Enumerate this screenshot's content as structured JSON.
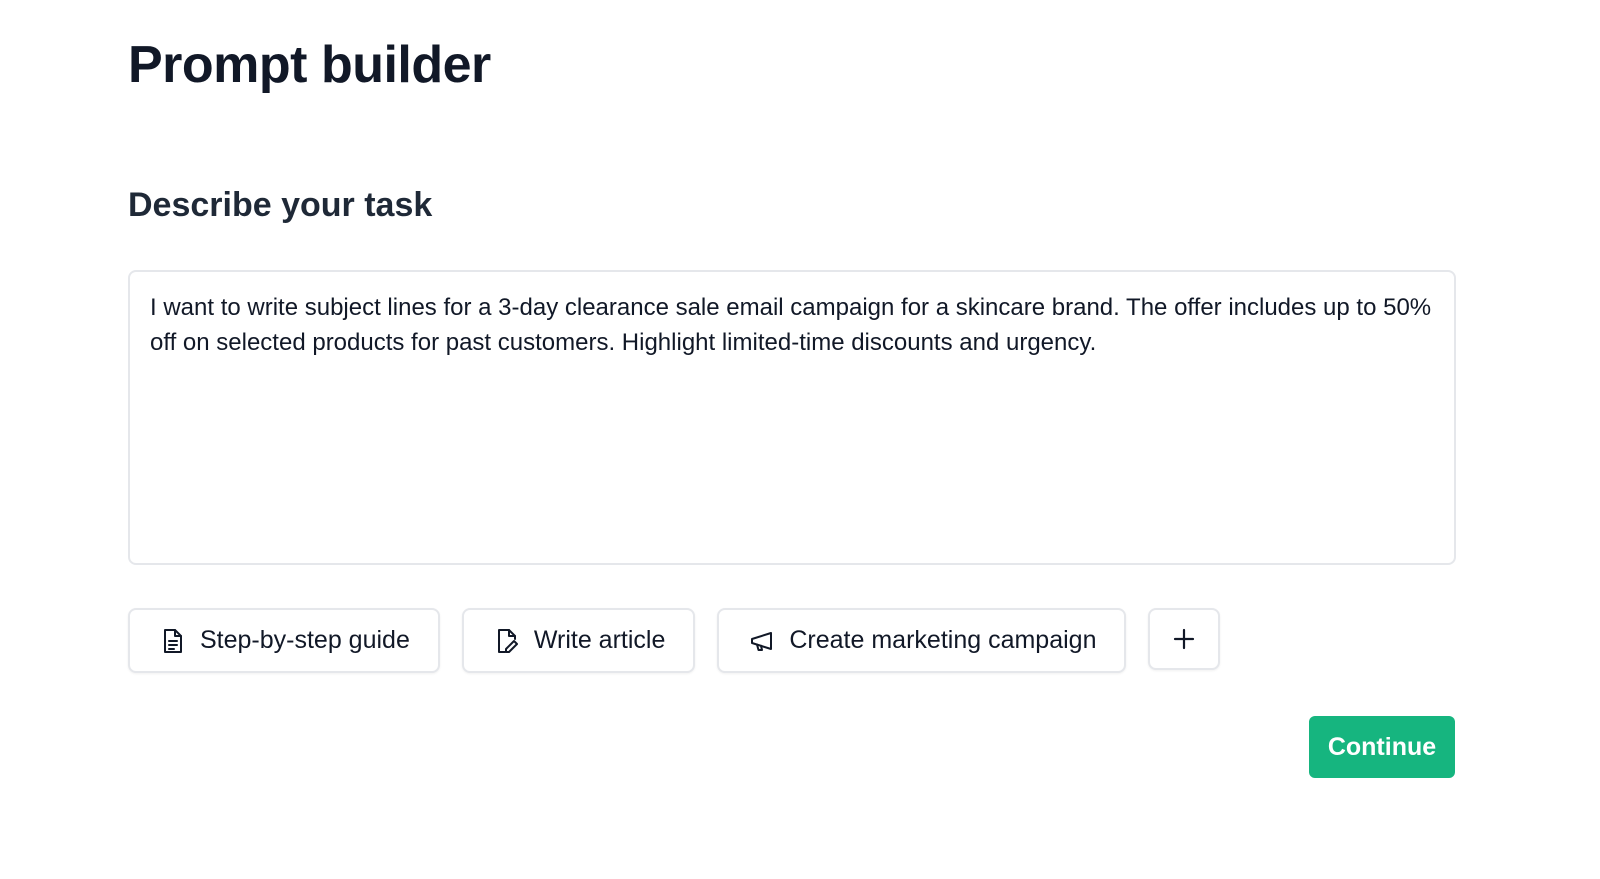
{
  "page": {
    "title": "Prompt builder"
  },
  "task": {
    "heading": "Describe your task",
    "text": "I want to write subject lines for a 3-day clearance sale email campaign for a skincare brand. The offer includes up to 50% off on selected products for past customers. Highlight limited-time discounts and urgency."
  },
  "suggestions": [
    {
      "label": "Step-by-step guide",
      "icon": "document-icon"
    },
    {
      "label": "Write article",
      "icon": "file-edit-icon"
    },
    {
      "label": "Create marketing campaign",
      "icon": "megaphone-icon"
    }
  ],
  "add_suggestion": {
    "icon": "plus-icon"
  },
  "actions": {
    "continue_label": "Continue"
  },
  "colors": {
    "accent": "#16b57f",
    "text": "#111827",
    "border": "#e5e7eb"
  }
}
